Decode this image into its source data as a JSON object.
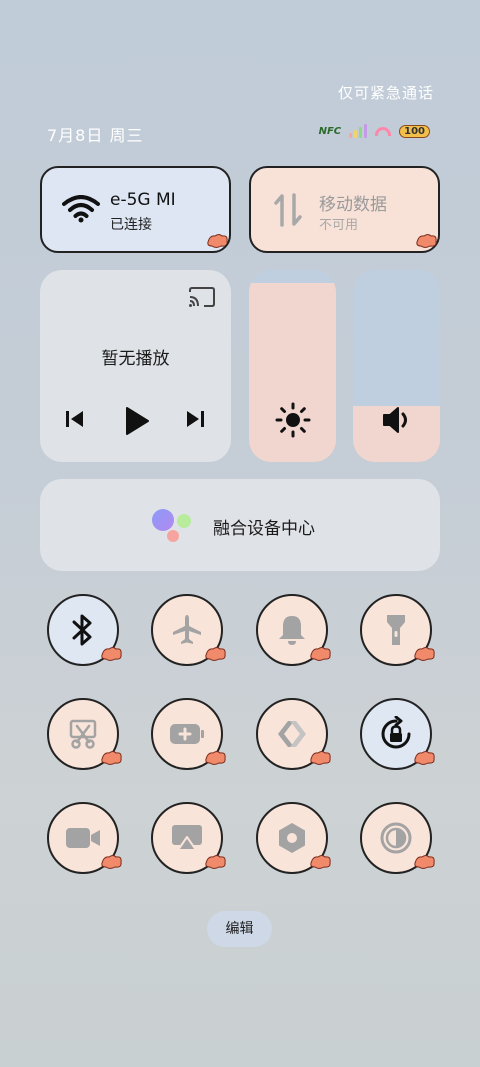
{
  "status_bar": {
    "emergency_text": "仅可紧急通话",
    "date_text": "7月8日 周三",
    "nfc_label": "NFC",
    "battery_level": "100"
  },
  "wifi_tile": {
    "network_name": "e-5G MI",
    "status": "已连接",
    "icon": "wifi-icon"
  },
  "data_tile": {
    "title": "移动数据",
    "status": "不可用",
    "icon": "data-transfer-icon"
  },
  "media": {
    "title": "暂无播放",
    "controls": [
      "previous-icon",
      "play-icon",
      "next-icon"
    ]
  },
  "sliders": {
    "brightness_level": 0.93,
    "volume_level": 0.29
  },
  "fusion": {
    "label": "融合设备中心"
  },
  "quick_settings": [
    {
      "name": "bluetooth",
      "icon": "bluetooth-icon",
      "active": true
    },
    {
      "name": "airplane",
      "icon": "airplane-icon",
      "active": false
    },
    {
      "name": "ring-mode",
      "icon": "bell-icon",
      "active": false
    },
    {
      "name": "flashlight",
      "icon": "flashlight-icon",
      "active": false
    },
    {
      "name": "screenshot",
      "icon": "scissors-icon",
      "active": false
    },
    {
      "name": "battery-saver",
      "icon": "battery-plus-icon",
      "active": false
    },
    {
      "name": "multi-screen",
      "icon": "link-icon",
      "active": false
    },
    {
      "name": "rotation-lock",
      "icon": "rotation-lock-icon",
      "active": true
    },
    {
      "name": "screen-record",
      "icon": "video-camera-icon",
      "active": false
    },
    {
      "name": "screen-cast",
      "icon": "airplay-icon",
      "active": false
    },
    {
      "name": "nfc-setting",
      "icon": "hexagon-nut-icon",
      "active": false
    },
    {
      "name": "dark-mode",
      "icon": "contrast-icon",
      "active": false
    }
  ],
  "edit_button": {
    "label": "编辑"
  },
  "colors": {
    "active_tile": "#dfe7f3",
    "inactive_tile": "#f9e4da",
    "slider_fill": "#f0d6cf",
    "slider_track": "#bfcfe0"
  }
}
